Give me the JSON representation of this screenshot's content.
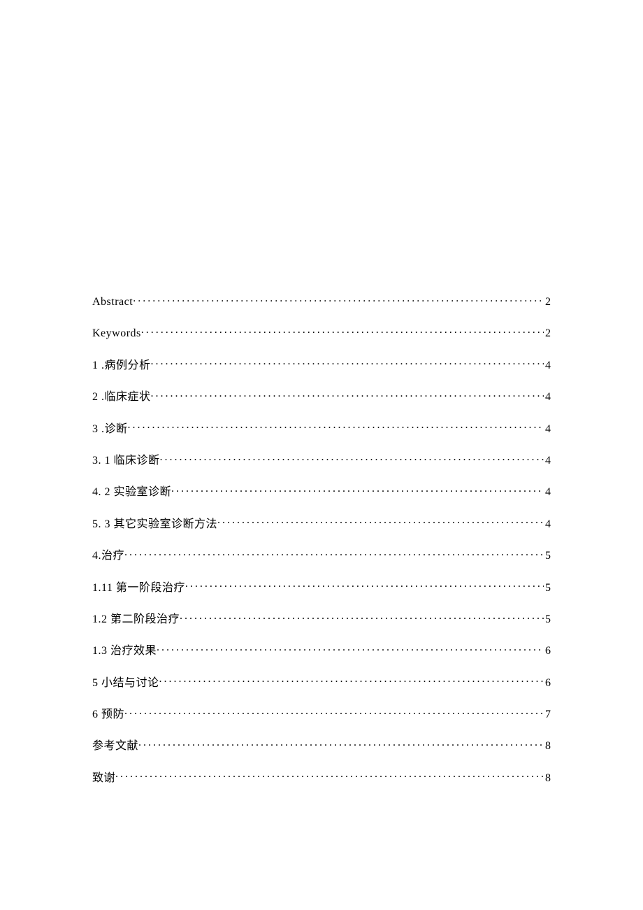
{
  "toc": [
    {
      "title": "Abstract",
      "page": "2"
    },
    {
      "title": "Keywords",
      "page": "2"
    },
    {
      "title": "1 .病例分析 ",
      "page": "4"
    },
    {
      "title": "2 .临床症状 ",
      "page": "4"
    },
    {
      "title": "3 .诊断",
      "page": "4"
    },
    {
      "title": "3. 1 临床诊断",
      "page": "4"
    },
    {
      "title": "4. 2 实验室诊断",
      "page": "4"
    },
    {
      "title": "5. 3 其它实验室诊断方法",
      "page": "4"
    },
    {
      "title": "4.治疗",
      "page": "5"
    },
    {
      "title": "1.11 第一阶段治疗",
      "page": "5"
    },
    {
      "title": "1.2  第二阶段治疗",
      "page": "5"
    },
    {
      "title": "1.3  治疗效果",
      "page": "6"
    },
    {
      "title": "5 小结与讨论 ",
      "page": "6"
    },
    {
      "title": "6 预防 ",
      "page": "7"
    },
    {
      "title": "参考文献",
      "page": "8"
    },
    {
      "title": "致谢",
      "page": "8"
    }
  ]
}
